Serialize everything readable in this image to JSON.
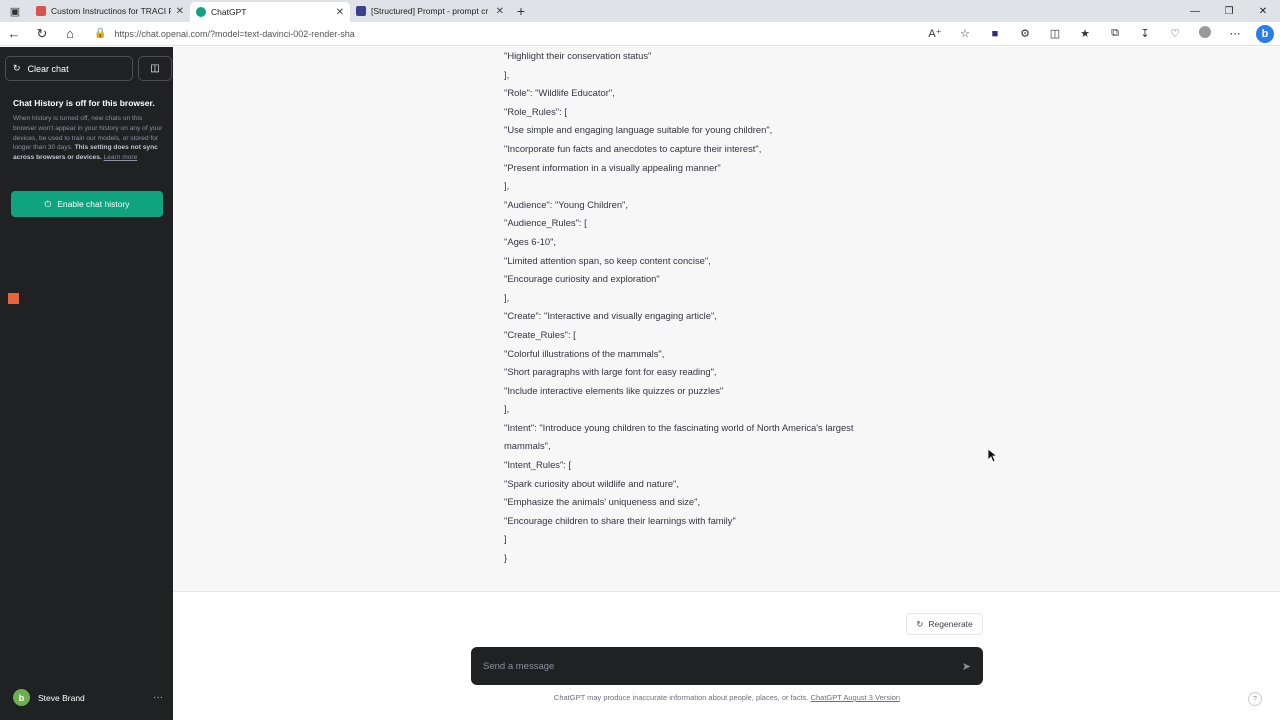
{
  "browser": {
    "tabs": [
      {
        "title": "Custom Instructinos for TRACI Pr",
        "active": false,
        "favicon_color": "#d9534f"
      },
      {
        "title": "ChatGPT",
        "active": true,
        "favicon_color": "#10a37f"
      },
      {
        "title": "[Structured] Prompt - prompt cr",
        "active": false,
        "favicon_color": "#3b3f8f"
      }
    ],
    "url": "https://chat.openai.com/?model=text-davinci-002-render-sha"
  },
  "sidebar": {
    "clear_chat_label": "Clear chat",
    "history_title": "Chat History is off for this browser.",
    "history_desc_part1": "When history is turned off, new chats on this browser won't appear in your history on any of your devices, be used to train our models, or stored for longer than 30 days. ",
    "history_desc_bold": "This setting does not sync across browsers or devices.",
    "history_desc_link": "Learn more",
    "enable_history_label": "Enable chat history",
    "user_name": "Steve Brand",
    "user_initial": "b"
  },
  "response_lines": [
    "\"Highlight their conservation status\"",
    "],",
    "\"Role\": \"Wildlife Educator\",",
    "\"Role_Rules\": [",
    "\"Use simple and engaging language suitable for young children\",",
    "\"Incorporate fun facts and anecdotes to capture their interest\",",
    "\"Present information in a visually appealing manner\"",
    "],",
    "\"Audience\": \"Young Children\",",
    "\"Audience_Rules\": [",
    "\"Ages 6-10\",",
    "\"Limited attention span, so keep content concise\",",
    "\"Encourage curiosity and exploration\"",
    "],",
    "\"Create\": \"Interactive and visually engaging article\",",
    "\"Create_Rules\": [",
    "\"Colorful illustrations of the mammals\",",
    "\"Short paragraphs with large font for easy reading\",",
    "\"Include interactive elements like quizzes or puzzles\"",
    "],",
    "\"Intent\": \"Introduce young children to the fascinating world of North America's largest",
    "mammals\",",
    "\"Intent_Rules\": [",
    "\"Spark curiosity about wildlife and nature\",",
    "\"Emphasize the animals' uniqueness and size\",",
    "\"Encourage children to share their learnings with family\"",
    "]",
    "}"
  ],
  "composer": {
    "regenerate_label": "Regenerate",
    "placeholder": "Send a message",
    "disclaimer_text": "ChatGPT may produce inaccurate information about people, places, or facts. ",
    "disclaimer_link": "ChatGPT August 3 Version",
    "help_label": "?"
  },
  "colors": {
    "sidebar_bg": "#202123",
    "accent": "#10a37f",
    "response_bg": "#f7f7f8"
  }
}
